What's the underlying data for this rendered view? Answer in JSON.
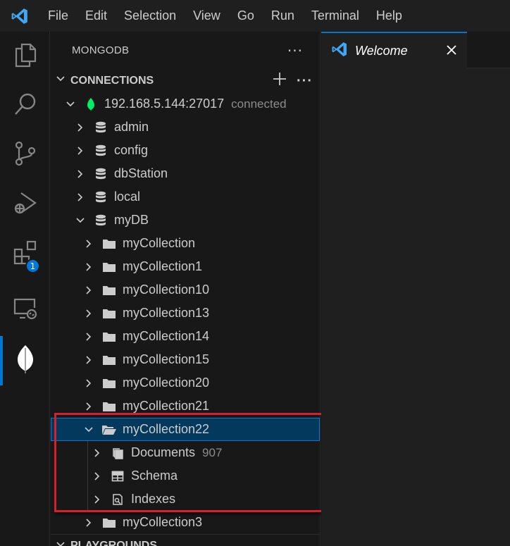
{
  "menu": [
    "File",
    "Edit",
    "Selection",
    "View",
    "Go",
    "Run",
    "Terminal",
    "Help"
  ],
  "activity_bar": {
    "items": [
      "files-icon",
      "search-icon",
      "source-control-icon",
      "run-debug-icon",
      "extensions-icon",
      "remote-explorer-icon",
      "mongodb-leaf-icon"
    ],
    "extensions_badge": "1",
    "active": "mongodb-leaf-icon"
  },
  "sidebar": {
    "title": "MONGODB",
    "connections_label": "CONNECTIONS",
    "playgrounds_label": "PLAYGROUNDS",
    "connection": {
      "host": "192.168.5.144:27017",
      "status": "connected"
    },
    "databases": [
      "admin",
      "config",
      "dbStation",
      "local",
      "myDB"
    ],
    "collections": [
      "myCollection",
      "myCollection1",
      "myCollection10",
      "myCollection13",
      "myCollection14",
      "myCollection15",
      "myCollection20",
      "myCollection21",
      "myCollection22"
    ],
    "expanded_collection_children": [
      {
        "label": "Documents",
        "count": "907"
      },
      {
        "label": "Schema"
      },
      {
        "label": "Indexes"
      }
    ],
    "after_collection": "myCollection3"
  },
  "editor": {
    "tab_label": "Welcome"
  },
  "colors": {
    "accent": "#0078d4",
    "mongo_green": "#00ed64",
    "highlight_red": "#d7202b"
  }
}
